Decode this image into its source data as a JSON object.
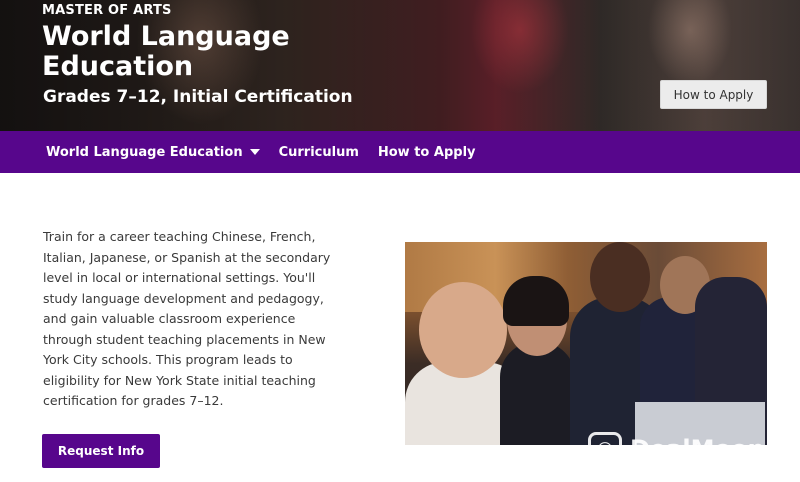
{
  "hero": {
    "eyebrow": "MASTER OF ARTS",
    "title": "World Language Education",
    "subtitle": "Grades 7–12, Initial Certification",
    "apply_button": "How to Apply"
  },
  "nav": {
    "items": [
      {
        "label": "World Language Education"
      },
      {
        "label": "Curriculum"
      },
      {
        "label": "How to Apply"
      }
    ]
  },
  "main": {
    "intro": "Train for a career teaching Chinese, French, Italian, Japanese, or Spanish at the secondary level in local or international settings. You'll study language development and pedagogy, and gain valuable classroom experience through student teaching placements in New York City schools. This program leads to eligibility for New York State initial teaching certification for grades 7–12.",
    "cta": "Request Info"
  },
  "watermark": {
    "text": "DealMoon",
    "icon": "dealmoon-logo-icon"
  },
  "colors": {
    "brand_purple": "#57068c",
    "hero_button_bg": "#ececec"
  }
}
